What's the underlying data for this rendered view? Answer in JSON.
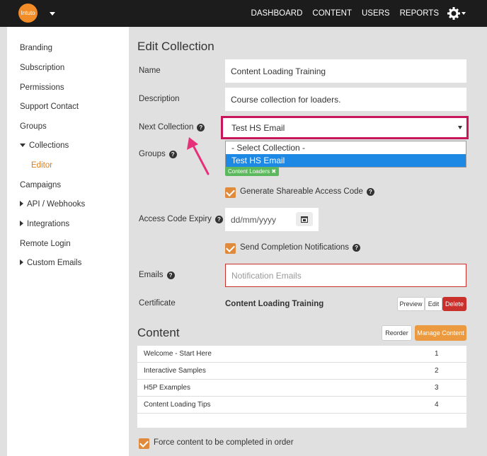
{
  "topbar": {
    "logo": "Intuto",
    "nav": [
      "DASHBOARD",
      "CONTENT",
      "USERS",
      "REPORTS"
    ]
  },
  "sidebar": {
    "items": [
      {
        "label": "Branding"
      },
      {
        "label": "Subscription"
      },
      {
        "label": "Permissions"
      },
      {
        "label": "Support Contact"
      },
      {
        "label": "Groups"
      },
      {
        "label": "Collections"
      },
      {
        "label": "Editor"
      },
      {
        "label": "Campaigns"
      },
      {
        "label": "API / Webhooks"
      },
      {
        "label": "Integrations"
      },
      {
        "label": "Remote Login"
      },
      {
        "label": "Custom Emails"
      }
    ]
  },
  "form": {
    "title": "Edit Collection",
    "name_label": "Name",
    "name_value": "Content Loading Training",
    "description_label": "Description",
    "description_value": "Course collection for loaders.",
    "next_label": "Next Collection",
    "next_value": "Test HS Email",
    "options": [
      "- Select Collection -",
      "Test HS Email"
    ],
    "groups_label": "Groups",
    "group_tag": "Content Loaders",
    "shareable_label": "Generate Shareable Access Code",
    "expiry_label": "Access Code Expiry",
    "expiry_placeholder": "dd/mm/yyyy",
    "completion_label": "Send Completion Notifications",
    "emails_label": "Emails",
    "emails_placeholder": "Notification Emails",
    "cert_label": "Certificate",
    "cert_value": "Content Loading Training",
    "preview_btn": "Preview",
    "edit_btn": "Edit",
    "delete_btn": "Delete"
  },
  "content": {
    "title": "Content",
    "reorder_btn": "Reorder",
    "manage_btn": "Manage Content",
    "rows": [
      {
        "title": "Welcome - Start Here",
        "num": "1"
      },
      {
        "title": "Interactive Samples",
        "num": "2"
      },
      {
        "title": "H5P Examples",
        "num": "3"
      },
      {
        "title": "Content Loading Tips",
        "num": "4"
      }
    ],
    "force_label": "Force content to be completed in order"
  },
  "colors": {
    "accent": "#e08a3c",
    "highlight": "#c7175a",
    "topbar": "#1c1c1c"
  }
}
